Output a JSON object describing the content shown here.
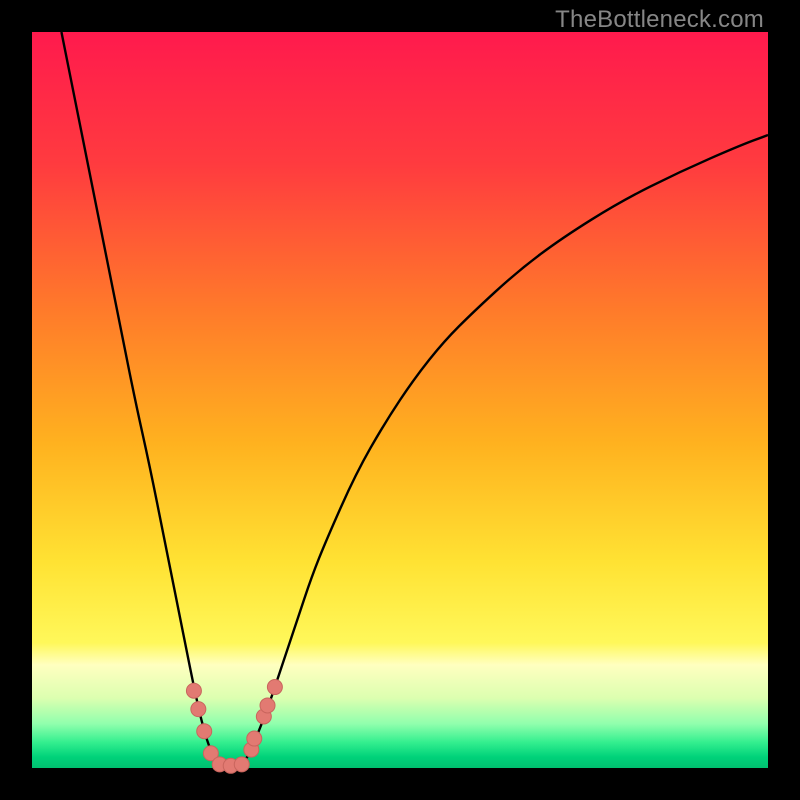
{
  "watermark": "TheBottleneck.com",
  "colors": {
    "black": "#000000",
    "curve": "#000000",
    "marker_fill": "#e27a72",
    "marker_stroke": "#c9655d"
  },
  "chart_data": {
    "type": "line",
    "title": "",
    "xlabel": "",
    "ylabel": "",
    "xlim": [
      0,
      100
    ],
    "ylim": [
      0,
      100
    ],
    "grid": false,
    "legend": false,
    "background_gradient": [
      {
        "pos": 0.0,
        "color": "#ff1a4d"
      },
      {
        "pos": 0.18,
        "color": "#ff3b3f"
      },
      {
        "pos": 0.38,
        "color": "#ff7b2a"
      },
      {
        "pos": 0.56,
        "color": "#ffb21f"
      },
      {
        "pos": 0.72,
        "color": "#ffe233"
      },
      {
        "pos": 0.83,
        "color": "#fff85a"
      },
      {
        "pos": 0.86,
        "color": "#ffffc0"
      },
      {
        "pos": 0.905,
        "color": "#dcffb0"
      },
      {
        "pos": 0.94,
        "color": "#90ffad"
      },
      {
        "pos": 0.965,
        "color": "#34ef8f"
      },
      {
        "pos": 0.985,
        "color": "#00d27a"
      },
      {
        "pos": 1.0,
        "color": "#00c070"
      }
    ],
    "series": [
      {
        "name": "bottleneck-curve",
        "x": [
          4,
          6,
          8,
          10,
          12,
          14,
          16,
          18,
          19,
          20,
          21,
          22,
          23,
          24,
          25,
          26,
          27,
          28,
          29,
          30,
          32,
          34,
          36,
          38,
          40,
          44,
          48,
          52,
          56,
          60,
          66,
          72,
          80,
          88,
          96,
          100
        ],
        "y": [
          100,
          90,
          80,
          70,
          60,
          50,
          41,
          31,
          26,
          21,
          16,
          11,
          6.5,
          3,
          1,
          0,
          0,
          0,
          1,
          3,
          8,
          14,
          20,
          26,
          31,
          40,
          47,
          53,
          58,
          62,
          67.5,
          72,
          77,
          81,
          84.5,
          86
        ]
      }
    ],
    "markers": [
      {
        "x": 22.0,
        "y": 10.5
      },
      {
        "x": 22.6,
        "y": 8.0
      },
      {
        "x": 23.4,
        "y": 5.0
      },
      {
        "x": 24.3,
        "y": 2.0
      },
      {
        "x": 25.5,
        "y": 0.5
      },
      {
        "x": 27.0,
        "y": 0.3
      },
      {
        "x": 28.5,
        "y": 0.5
      },
      {
        "x": 29.8,
        "y": 2.5
      },
      {
        "x": 30.2,
        "y": 4.0
      },
      {
        "x": 31.5,
        "y": 7.0
      },
      {
        "x": 32.0,
        "y": 8.5
      },
      {
        "x": 33.0,
        "y": 11.0
      }
    ]
  }
}
